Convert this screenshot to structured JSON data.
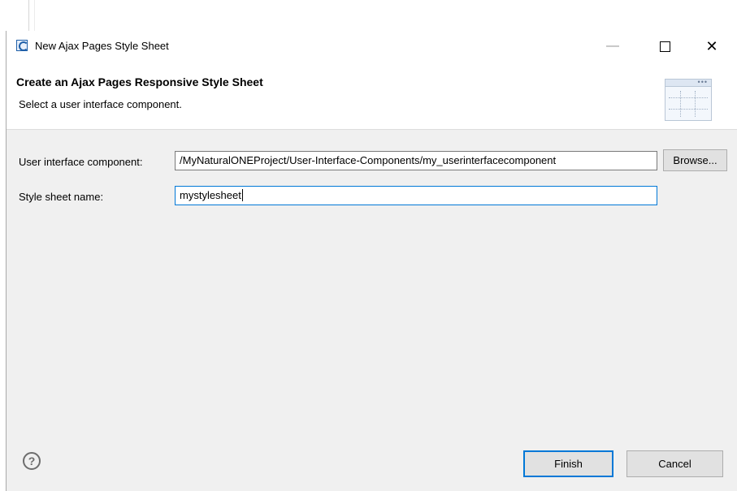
{
  "window": {
    "title": "New Ajax Pages Style Sheet",
    "minimize_glyph": "—",
    "close_glyph": "✕"
  },
  "banner": {
    "title": "Create an Ajax Pages Responsive Style Sheet",
    "description": "Select a user interface component.",
    "image_icon": "wizard-banner-icon"
  },
  "form": {
    "uic_label": "User interface component:",
    "uic_value": "/MyNaturalONEProject/User-Interface-Components/my_userinterfacecomponent",
    "browse_label": "Browse...",
    "ss_label": "Style sheet name:",
    "ss_value": "mystylesheet"
  },
  "footer": {
    "help_glyph": "?",
    "finish_label": "Finish",
    "cancel_label": "Cancel"
  },
  "colors": {
    "focus_accent": "#0078d7",
    "dialog_background": "#f0f0f0"
  }
}
